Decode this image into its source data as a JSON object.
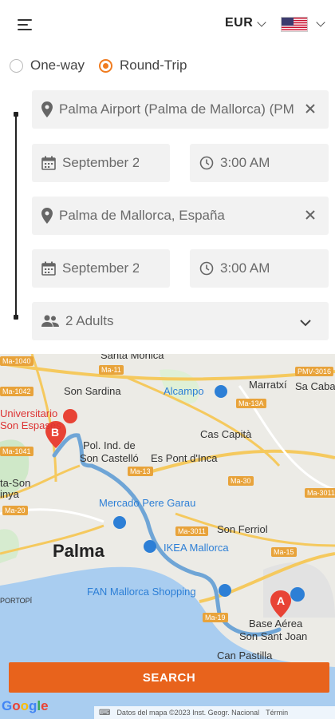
{
  "header": {
    "currency": "EUR",
    "flag": "us-flag-icon"
  },
  "trip": {
    "one_way_label": "One-way",
    "round_trip_label": "Round-Trip",
    "selected": "Round-Trip"
  },
  "pickup": {
    "location": "Palma Airport (Palma de Mallorca) (PMI)",
    "date": "September 2",
    "time": "3:00 AM"
  },
  "dropoff": {
    "location": "Palma de Mallorca, España",
    "date": "September 2",
    "time": "3:00 AM"
  },
  "passengers": {
    "label": "2 Adults"
  },
  "map": {
    "labels": {
      "santa_monica": "Santa Mònica",
      "son_sardina": "Son Sardina",
      "alcampo": "Alcampo",
      "marratxi": "Marratxí",
      "sa_cabana": "Sa Cabana",
      "universitario": "Universitario",
      "son_espases": "Son Espases",
      "cas_capita": "Cas Capità",
      "pol_ind": "Pol. Ind. de",
      "son_castello": "Son Castelló",
      "es_pont": "Es Pont d'Inca",
      "ta_son": "ta-Son",
      "inya": "inya",
      "mercado": "Mercado Pere Garau",
      "son_ferriol": "Son Ferriol",
      "palma": "Palma",
      "ikea": "IKEA Mallorca",
      "fan": "FAN Mallorca Shopping",
      "portopi": "PORTOPÍ",
      "base_aerea": "Base Aérea",
      "son_sant_joan": "Son Sant Joan",
      "can_pastilla": "Can Pastilla"
    },
    "badges": {
      "ma1040": "Ma-1040",
      "ma11": "Ma-11",
      "pmv3016": "PMV-3016",
      "ma1042": "Ma-1042",
      "ma13a": "Ma-13A",
      "ma1041": "Ma-1041",
      "ma13": "Ma-13",
      "ma30": "Ma-30",
      "ma3011b": "Ma-3011",
      "ma20": "Ma-20",
      "ma3011": "Ma-3011",
      "ma15": "Ma-15",
      "ma19": "Ma-19"
    },
    "marker_a": "A",
    "marker_b": "B",
    "google": "Google",
    "attribution": "Datos del mapa ©2023 Inst. Geogr. Nacional",
    "terms": "Términ"
  },
  "search_label": "SEARCH",
  "colors": {
    "accent": "#f07c20",
    "button": "#e8631c",
    "route": "#6fa5d6"
  }
}
